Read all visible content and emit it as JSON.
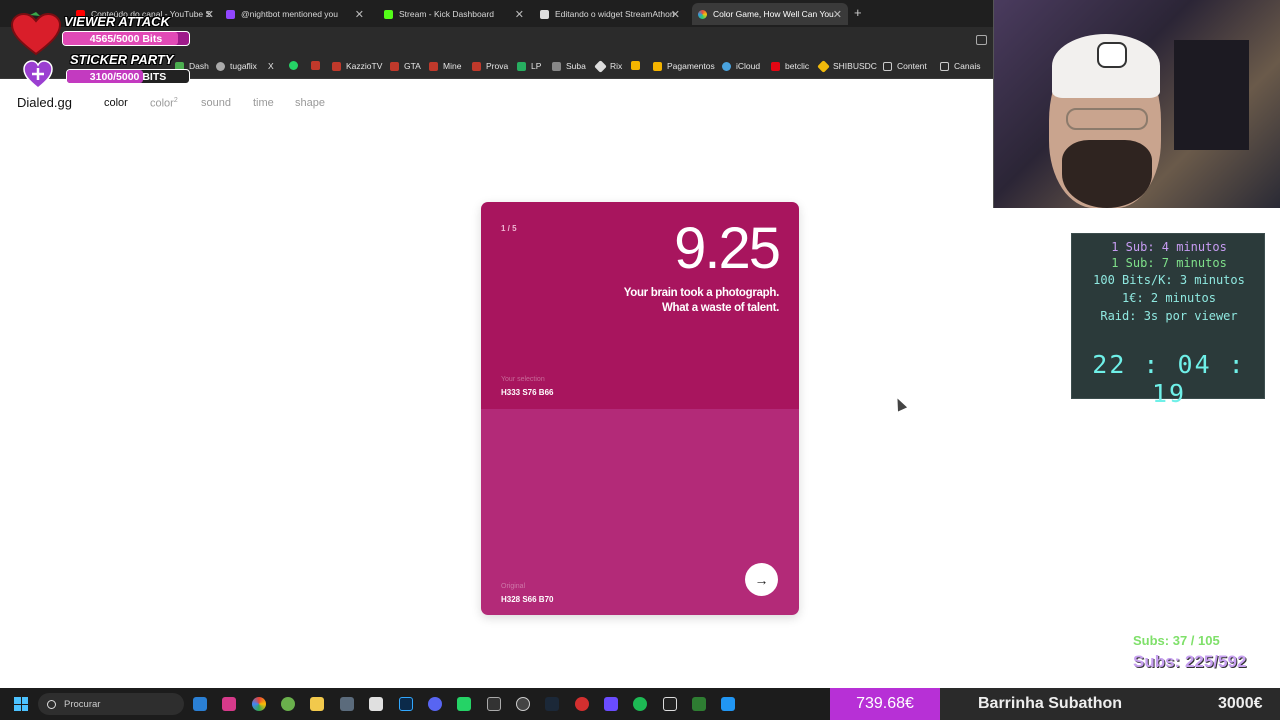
{
  "browser": {
    "tabs": [
      {
        "title": "Conteúdo do canal - YouTube S",
        "icon_color": "#ff0000",
        "active": false
      },
      {
        "title": "@nightbot mentioned you",
        "icon_color": "#9146ff",
        "active": false
      },
      {
        "title": "Stream - Kick Dashboard",
        "icon_color": "#53fc18",
        "active": false
      },
      {
        "title": "Editando o widget StreamAthon",
        "icon_color": "#dddddd",
        "active": false
      },
      {
        "title": "Color Game, How Well Can You",
        "icon_color": "#e74c8c",
        "active": true
      }
    ],
    "new_tab": "+",
    "close_glyph": "✕",
    "bookmarks": [
      "Dash",
      "tugaflix",
      "X",
      "",
      "",
      "KazzioTV",
      "GTA",
      "Mine",
      "Prova",
      "LP",
      "Suba",
      "Rix",
      "Pagamentos",
      "iCloud",
      "betclic",
      "SHIBUSDC",
      "Content",
      "Canais"
    ]
  },
  "site": {
    "logo": "Dialed.gg",
    "nav": {
      "color": "color",
      "color2": "color",
      "color2_sup": "2",
      "sound": "sound",
      "time": "time",
      "shape": "shape"
    }
  },
  "card": {
    "progress": "1 / 5",
    "score": "9.25",
    "comment_line1": "Your brain took a photograph.",
    "comment_line2": "What a waste of talent.",
    "selection_label": "Your selection",
    "selection_value": "H333 S76 B66",
    "original_label": "Original",
    "original_value": "H328 S66 B70",
    "selection_color": "#a8155e",
    "original_color": "#b32a78",
    "next_glyph": "→"
  },
  "overlay": {
    "viewer_attack_title": "VIEWER ATTACK",
    "viewer_attack_bits": "4565/5000 Bits",
    "sticker_party_title": "STICKER PARTY",
    "sticker_party_bits": "3100/5000 BITS",
    "viewer_attack_progress": 0.913,
    "sticker_party_progress": 0.62,
    "timer_rules": [
      {
        "text": "1 Sub: 4 minutos",
        "color": "#c79cf2"
      },
      {
        "text": "1 Sub: 7 minutos",
        "color": "#7fe08a"
      },
      {
        "text": "100 Bits/K: 3 minutos",
        "color": "#8fe8e0"
      },
      {
        "text": "1€: 2 minutos",
        "color": "#8fe8e0"
      },
      {
        "text": "Raid: 3s por viewer",
        "color": "#8fe8e0"
      }
    ],
    "timer_clock": "22 : 04 : 19",
    "subs_goal_1": "Subs: 37 / 105",
    "subs_goal_2": "Subs: 225/592"
  },
  "taskbar": {
    "search_placeholder": "Procurar",
    "subathon_amount": "739.68€",
    "subathon_label": "Barrinha Subathon",
    "subathon_goal": "3000€",
    "subathon_progress": 0.2466
  }
}
